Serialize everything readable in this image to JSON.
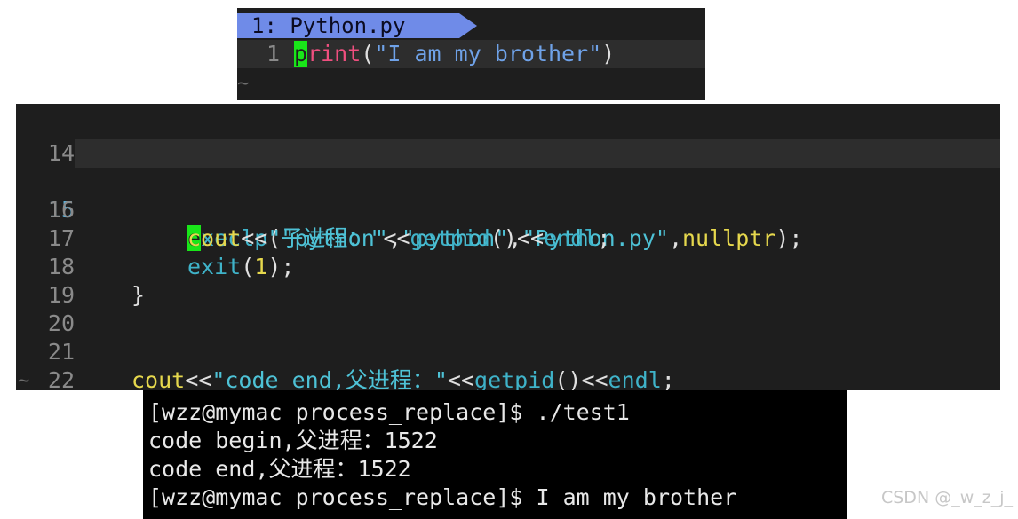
{
  "colors": {
    "editor_bg": "#1e1e1e",
    "current_line_bg": "#2d2d2d",
    "tab_bg": "#6f8be8",
    "terminal_bg": "#000000",
    "cursor": "#19e619",
    "keyword": "#e6d84d",
    "function": "#3fb3c9",
    "python_print": "#ef4f7f",
    "python_string": "#6fa2e8"
  },
  "top_editor": {
    "tab_label": "1: Python.py",
    "line_number": "1",
    "cursor_char": "p",
    "fn_rest": "rint",
    "open_paren": "(",
    "string": "\"I am my brother\"",
    "close_paren": ")",
    "tilde": "~"
  },
  "mid_editor": {
    "tilde": "~",
    "lines": [
      {
        "num": "14"
      },
      {
        "num": "15",
        "cursor_char": "e",
        "fn_rest": "xeclp",
        "open": "(",
        "s1": "\"python\"",
        "c1": ",",
        "s2": "\"python\"",
        "c2": ",",
        "s3": "\"Python.py\"",
        "c3": ",",
        "kw": "nullptr",
        "close": ");"
      },
      {
        "num": "16",
        "kw": "cout",
        "op": "<<",
        "str": "\"子进程：\"",
        "op2": "<<",
        "fn": "getpid",
        "paren": "()",
        "op3": "<<",
        "fn2": "endl",
        "semi": ";"
      },
      {
        "num": "17",
        "fn": "exit",
        "open": "(",
        "arg": "1",
        "close": ");"
      },
      {
        "num": "18",
        "brace": "}"
      },
      {
        "num": "19"
      },
      {
        "num": "20"
      },
      {
        "num": "21",
        "kw": "cout",
        "op": "<<",
        "str": "\"code end,父进程：\"",
        "op2": "<<",
        "fn": "getpid",
        "paren": "()",
        "op3": "<<",
        "fn2": "endl",
        "semi": ";"
      },
      {
        "num": "22",
        "brace": "}"
      }
    ]
  },
  "terminal": {
    "lines": [
      "[wzz@mymac process_replace]$ ./test1",
      "code begin,父进程：1522",
      "code end,父进程：1522",
      "[wzz@mymac process_replace]$ I am my brother"
    ]
  },
  "watermark": "CSDN @_w_z_j_"
}
